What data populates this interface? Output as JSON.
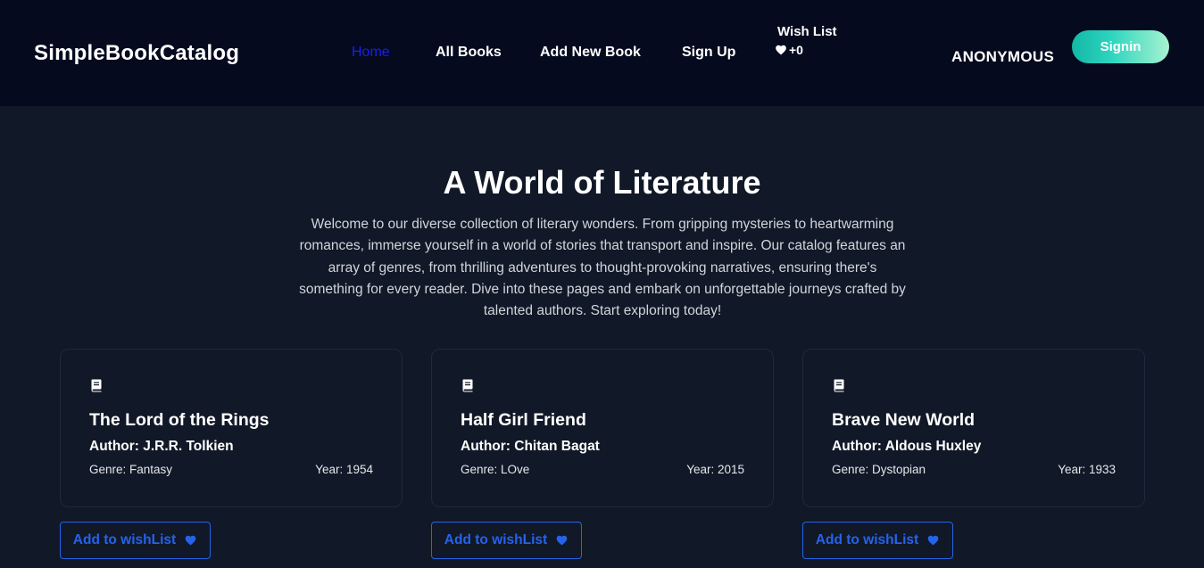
{
  "navbar": {
    "brand": "SimpleBookCatalog",
    "links": [
      {
        "label": "Home",
        "active": true
      },
      {
        "label": "All Books"
      },
      {
        "label": "Add New Book"
      },
      {
        "label": "Sign Up"
      }
    ],
    "wishlist": {
      "label": "Wish List",
      "count": "+0",
      "icon": "heart-icon"
    },
    "user": "ANONYMOUS",
    "signin_label": "Signin"
  },
  "hero": {
    "title": "A World of Literature",
    "text": "Welcome to our diverse collection of literary wonders. From gripping mysteries to heartwarming romances, immerse yourself in a world of stories that transport and inspire. Our catalog features an array of genres, from thrilling adventures to thought-provoking narratives, ensuring there's something for every reader. Dive into these pages and embark on unforgettable journeys crafted by talented authors. Start exploring today!"
  },
  "books": [
    {
      "title": "The Lord of the Rings",
      "author": "Author: J.R.R. Tolkien",
      "genre": "Genre: Fantasy",
      "year": "Year: 1954",
      "wish_label": "Add to wishList",
      "icon": "book-icon"
    },
    {
      "title": "Half Girl Friend",
      "author": "Author: Chitan Bagat",
      "genre": "Genre: LOve",
      "year": "Year: 2015",
      "wish_label": "Add to wishList",
      "icon": "book-icon"
    },
    {
      "title": "Brave New World",
      "author": "Author: Aldous Huxley",
      "genre": "Genre: Dystopian",
      "year": "Year: 1933",
      "wish_label": "Add to wishList",
      "icon": "book-icon"
    }
  ],
  "colors": {
    "nav_bg": "#050a1e",
    "page_bg": "#111827",
    "active_link": "#1d1df2",
    "accent_blue": "#2563eb",
    "signin_gradient_start": "#14b8a6",
    "signin_gradient_end": "#a7f3d0"
  }
}
